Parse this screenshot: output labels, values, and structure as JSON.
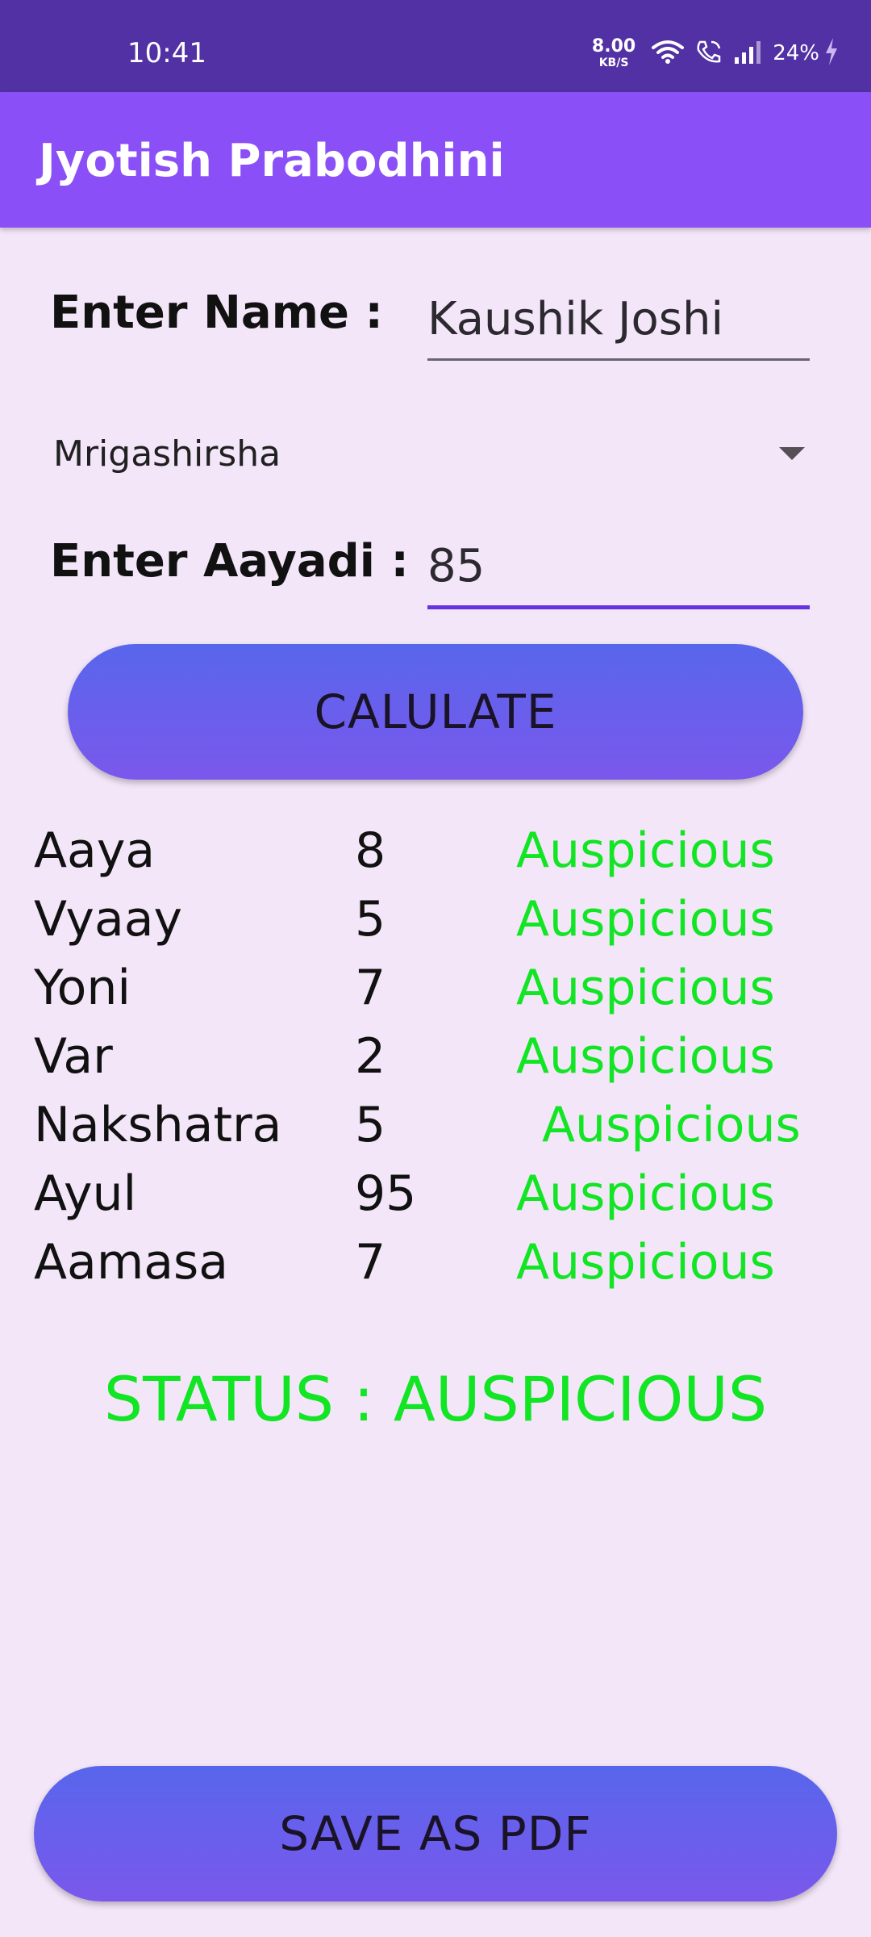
{
  "status_bar": {
    "time": "10:41",
    "net_speed_value": "8.00",
    "net_speed_unit": "KB/S",
    "battery": "24%"
  },
  "app_bar": {
    "title": "Jyotish Prabodhini"
  },
  "form": {
    "name_label": "Enter Name :",
    "name_value": "Kaushik Joshi",
    "nakshatra_selected": "Mrigashirsha",
    "aayadi_label": "Enter Aayadi :",
    "aayadi_value": "85"
  },
  "buttons": {
    "calculate": "CALULATE",
    "save_pdf": "SAVE AS PDF"
  },
  "results": [
    {
      "name": "Aaya",
      "value": "8",
      "result": "Auspicious"
    },
    {
      "name": "Vyaay",
      "value": "5",
      "result": "Auspicious"
    },
    {
      "name": "Yoni",
      "value": "7",
      "result": "Auspicious"
    },
    {
      "name": "Var",
      "value": "2",
      "result": "Auspicious"
    },
    {
      "name": "Nakshatra",
      "value": "5",
      "result": "Auspicious"
    },
    {
      "name": "Ayul",
      "value": "95",
      "result": "Auspicious"
    },
    {
      "name": "Aamasa",
      "value": "7",
      "result": "Auspicious"
    }
  ],
  "status_text": "STATUS : AUSPICIOUS",
  "colors": {
    "status_bar": "#5231a4",
    "app_bar": "#8b4ff8",
    "background": "#f3e6f8",
    "auspicious": "#12e524",
    "accent": "#6732e0"
  }
}
